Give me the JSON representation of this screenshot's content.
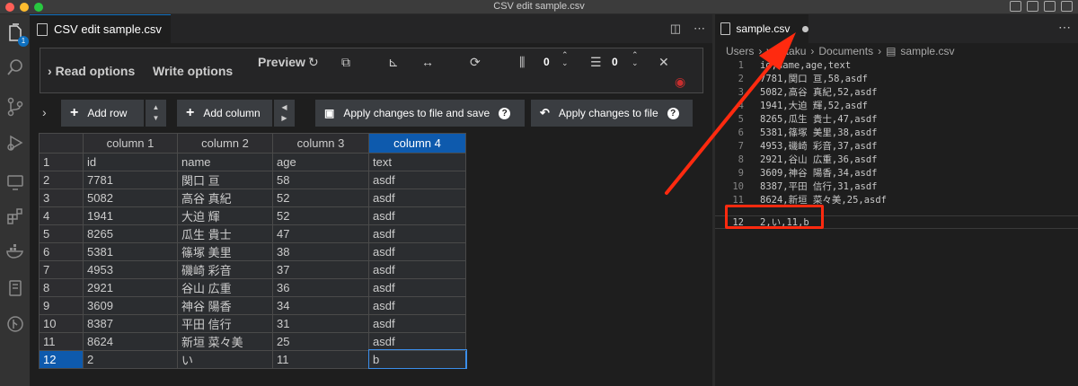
{
  "window": {
    "title": "CSV edit sample.csv"
  },
  "activity_bar": {
    "badge_count": "1"
  },
  "left_editor": {
    "tab_label": "CSV edit sample.csv",
    "options": {
      "read_label": "Read options",
      "write_label": "Write options",
      "preview_label": "Preview",
      "fixed_rows_value": "0",
      "fixed_cols_value": "0"
    },
    "toolbar": {
      "add_row_label": "Add row",
      "add_column_label": "Add column",
      "apply_save_label": "Apply changes to file and save",
      "apply_label": "Apply changes to file"
    },
    "grid": {
      "columns": [
        "column 1",
        "column 2",
        "column 3",
        "column 4"
      ],
      "rows": [
        [
          "1",
          "id",
          "name",
          "age",
          "text"
        ],
        [
          "2",
          "7781",
          "関口 亘",
          "58",
          "asdf"
        ],
        [
          "3",
          "5082",
          "高谷 真紀",
          "52",
          "asdf"
        ],
        [
          "4",
          "1941",
          "大迫 輝",
          "52",
          "asdf"
        ],
        [
          "5",
          "8265",
          "瓜生 貴士",
          "47",
          "asdf"
        ],
        [
          "6",
          "5381",
          "篠塚 美里",
          "38",
          "asdf"
        ],
        [
          "7",
          "4953",
          "磯崎 彩音",
          "37",
          "asdf"
        ],
        [
          "8",
          "2921",
          "谷山 広重",
          "36",
          "asdf"
        ],
        [
          "9",
          "3609",
          "神谷 陽香",
          "34",
          "asdf"
        ],
        [
          "10",
          "8387",
          "平田 信行",
          "31",
          "asdf"
        ],
        [
          "11",
          "8624",
          "新垣 菜々美",
          "25",
          "asdf"
        ],
        [
          "12",
          "2",
          "い",
          "11",
          "b"
        ]
      ]
    }
  },
  "right_editor": {
    "tab_label": "sample.csv",
    "breadcrumb": [
      "Users",
      "yositaku",
      "Documents",
      "sample.csv"
    ],
    "lines": [
      {
        "n": "1",
        "text": "id,name,age,text"
      },
      {
        "n": "2",
        "text": "7781,関口 亘,58,asdf"
      },
      {
        "n": "3",
        "text": "5082,高谷 真紀,52,asdf"
      },
      {
        "n": "4",
        "text": "1941,大迫 輝,52,asdf"
      },
      {
        "n": "5",
        "text": "8265,瓜生 貴士,47,asdf"
      },
      {
        "n": "6",
        "text": "5381,篠塚 美里,38,asdf"
      },
      {
        "n": "7",
        "text": "4953,磯崎 彩音,37,asdf"
      },
      {
        "n": "8",
        "text": "2921,谷山 広重,36,asdf"
      },
      {
        "n": "9",
        "text": "3609,神谷 陽香,34,asdf"
      },
      {
        "n": "10",
        "text": "8387,平田 信行,31,asdf"
      },
      {
        "n": "11",
        "text": "8624,新垣 菜々美,25,asdf"
      },
      {
        "n": "12",
        "text": "2,い,11,b"
      }
    ]
  },
  "colors": {
    "accent": "#0e70c0",
    "selection": "#0e5aad",
    "annotation": "#ff2a0f"
  }
}
